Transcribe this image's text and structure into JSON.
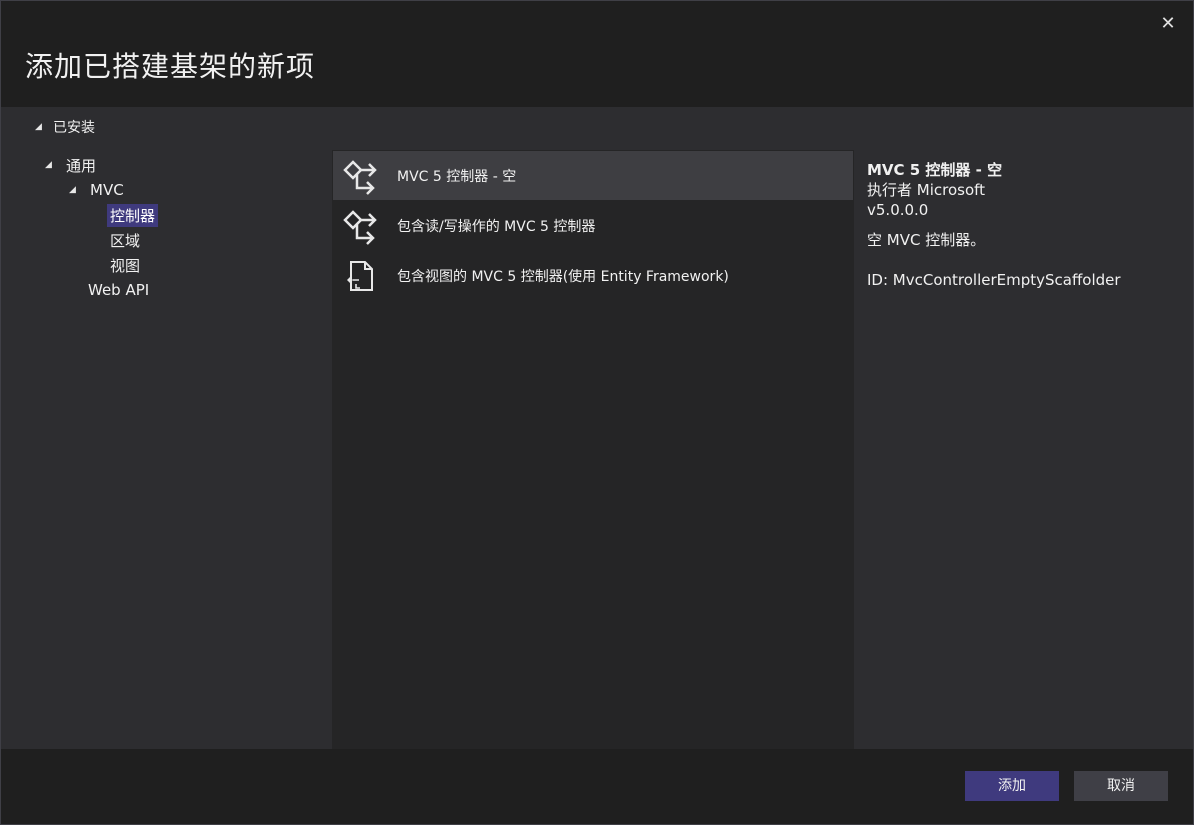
{
  "dialog": {
    "title": "添加已搭建基架的新项",
    "close_glyph": "✕"
  },
  "tree": {
    "installed_label": "已安装",
    "general_label": "通用",
    "mvc_label": "MVC",
    "controller_label": "控制器",
    "area_label": "区域",
    "view_label": "视图",
    "webapi_label": "Web API",
    "expanded_glyph": "◢"
  },
  "templates": [
    {
      "label": "MVC 5 控制器 - 空",
      "icon": "controller-icon",
      "selected": true
    },
    {
      "label": "包含读/写操作的 MVC 5 控制器",
      "icon": "controller-icon",
      "selected": false
    },
    {
      "label": "包含视图的 MVC 5 控制器(使用 Entity Framework)",
      "icon": "view-controller-icon",
      "selected": false
    }
  ],
  "details": {
    "name": "MVC 5 控制器 - 空",
    "author": "执行者 Microsoft",
    "version": "v5.0.0.0",
    "description": "空 MVC 控制器。",
    "id": "ID: MvcControllerEmptyScaffolder"
  },
  "buttons": {
    "add": "添加",
    "cancel": "取消"
  },
  "colors": {
    "accent": "#3f3a7e",
    "background": "#1f1f1f",
    "panel": "#2d2d30",
    "list": "#252526",
    "selected_item": "#3e3e42"
  }
}
